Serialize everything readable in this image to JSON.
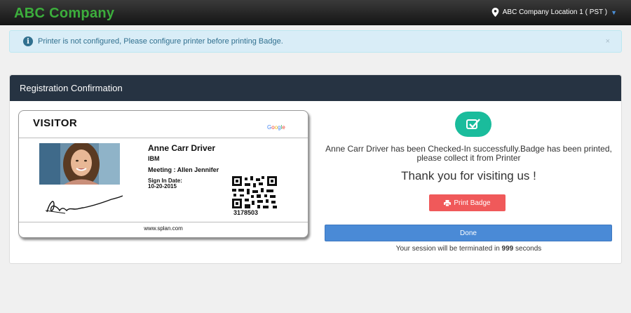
{
  "header": {
    "brand": "ABC Company",
    "location": "ABC Company Location 1 ( PST )"
  },
  "alert": {
    "message": "Printer is not configured, Please configure printer before printing Badge.",
    "close": "×"
  },
  "panel": {
    "title": "Registration Confirmation"
  },
  "badge": {
    "type": "VISITOR",
    "logo_text": "Google",
    "name": "Anne Carr Driver",
    "company": "IBM",
    "meeting": "Meeting : Allen Jennifer",
    "signin_label": "Sign In Date:",
    "signin_date": "10-20-2015",
    "id": "3178503",
    "footer": "www.splan.com"
  },
  "confirmation": {
    "message": "Anne Carr Driver has been Checked-In successfully.Badge has been printed, please collect it from Printer",
    "thanks": "Thank you for visiting us !",
    "print_label": "Print Badge",
    "done_label": "Done",
    "session_prefix": "Your session will be terminated in",
    "session_seconds": "999",
    "session_suffix": "seconds"
  },
  "colors": {
    "brand": "#3cae3c",
    "panel_header": "#263342",
    "success": "#1abc9c",
    "print": "#f0595a",
    "done": "#4a8ad6"
  }
}
